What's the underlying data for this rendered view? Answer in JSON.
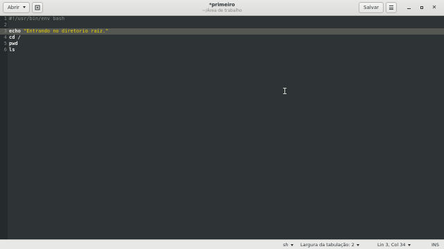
{
  "header": {
    "open_label": "Abrir",
    "save_label": "Salvar",
    "title": "*primeiro",
    "subtitle": "~/Área de trabalho",
    "icons": {
      "new_tab": "new-document-icon",
      "menu": "hamburger-menu-icon",
      "minimize": "minimize-icon",
      "maximize": "maximize-icon",
      "close": "close-icon"
    },
    "close_glyph": "✕"
  },
  "editor": {
    "current_line": 3,
    "lines": [
      {
        "num": "1",
        "parts": [
          {
            "text": "#!/usr/bin/env bash",
            "cls": "comment"
          }
        ]
      },
      {
        "num": "2",
        "parts": []
      },
      {
        "num": "3",
        "parts": [
          {
            "text": "echo",
            "cls": "kw"
          },
          {
            "text": " ",
            "cls": ""
          },
          {
            "text": "\"Entrando no diretorio raiz.\"",
            "cls": "str"
          }
        ]
      },
      {
        "num": "4",
        "parts": [
          {
            "text": "cd",
            "cls": "kw"
          },
          {
            "text": " /",
            "cls": ""
          }
        ]
      },
      {
        "num": "5",
        "parts": [
          {
            "text": "pwd",
            "cls": "kw"
          }
        ]
      },
      {
        "num": "6",
        "parts": [
          {
            "text": "ls",
            "cls": "kw"
          }
        ]
      }
    ],
    "colors": {
      "background": "#2e3436",
      "current_line": "#555753",
      "string": "#edd400",
      "comment": "#888a85"
    }
  },
  "statusbar": {
    "language": "sh",
    "tab_width": "Largura da tabulação: 2",
    "position": "Lin 3, Col 34",
    "mode": "INS"
  }
}
